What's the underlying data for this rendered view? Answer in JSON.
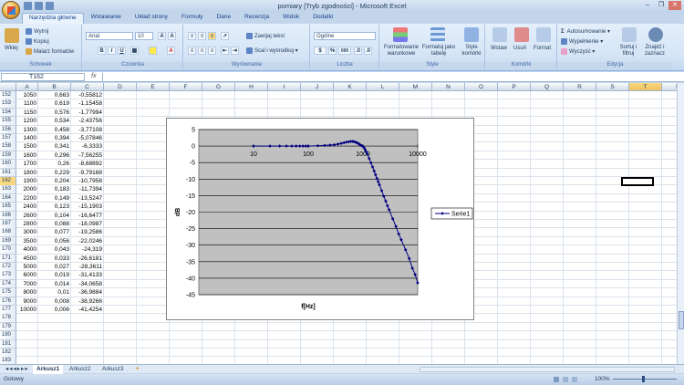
{
  "window": {
    "title": "pomiary  [Tryb zgodności] - Microsoft Excel",
    "min": "–",
    "restore": "❐",
    "close": "✕"
  },
  "tabs": [
    "Narzędzia główne",
    "Wstawianie",
    "Układ strony",
    "Formuły",
    "Dane",
    "Recenzja",
    "Widok",
    "Dodatki"
  ],
  "ribbon": {
    "clipboard": {
      "paste": "Wklej",
      "cut": "Wytnij",
      "copy": "Kopiuj",
      "painter": "Malarz formatów",
      "label": "Schowek"
    },
    "font": {
      "name": "Arial",
      "size": "10",
      "bold": "B",
      "italic": "I",
      "underline": "U",
      "label": "Czcionka"
    },
    "alignment": {
      "wrap": "Zawijaj tekst",
      "merge": "Scal i wyśrodkuj",
      "label": "Wyrównanie"
    },
    "number": {
      "format": "Ogólne",
      "label": "Liczba",
      "percent": "%",
      "thousands": "000"
    },
    "styles": {
      "cond": "Formatowanie warunkowe",
      "table": "Formatuj jako tabelę",
      "cell": "Style komórki",
      "label": "Style"
    },
    "cells": {
      "insert": "Wstaw",
      "delete": "Usuń",
      "format": "Format",
      "label": "Komórki"
    },
    "editing": {
      "autosum": "Autosumowanie",
      "fill": "Wypełnienie",
      "clear": "Wyczyść",
      "sort": "Sortuj i filtruj",
      "find": "Znajdź i zaznacz",
      "label": "Edycja"
    }
  },
  "namebox": "T162",
  "fx": "fx",
  "columns": [
    "A",
    "B",
    "C",
    "D",
    "E",
    "F",
    "G",
    "H",
    "I",
    "J",
    "K",
    "L",
    "M",
    "N",
    "O",
    "P",
    "Q",
    "R",
    "S",
    "T",
    "U"
  ],
  "rows": [
    {
      "n": "152",
      "a": "1050",
      "b": "0,663",
      "c": "-0,55812"
    },
    {
      "n": "153",
      "a": "1100",
      "b": "0,619",
      "c": "-1,15458"
    },
    {
      "n": "154",
      "a": "1150",
      "b": "0,576",
      "c": "-1,77994"
    },
    {
      "n": "155",
      "a": "1200",
      "b": "0,534",
      "c": "-2,43756"
    },
    {
      "n": "156",
      "a": "1300",
      "b": "0,458",
      "c": "-3,77108"
    },
    {
      "n": "157",
      "a": "1400",
      "b": "0,394",
      "c": "-5,07846"
    },
    {
      "n": "158",
      "a": "1500",
      "b": "0,341",
      "c": "-6,3333"
    },
    {
      "n": "159",
      "a": "1600",
      "b": "0,296",
      "c": "-7,56255"
    },
    {
      "n": "160",
      "a": "1700",
      "b": "0,26",
      "c": "-8,68892"
    },
    {
      "n": "161",
      "a": "1800",
      "b": "0,229",
      "c": "-9,79168"
    },
    {
      "n": "162",
      "a": "1900",
      "b": "0,204",
      "c": "-10,7958"
    },
    {
      "n": "163",
      "a": "2000",
      "b": "0,183",
      "c": "-11,7394"
    },
    {
      "n": "164",
      "a": "2200",
      "b": "0,149",
      "c": "-13,5247"
    },
    {
      "n": "165",
      "a": "2400",
      "b": "0,123",
      "c": "-15,1903"
    },
    {
      "n": "166",
      "a": "2600",
      "b": "0,104",
      "c": "-16,6477"
    },
    {
      "n": "167",
      "a": "2800",
      "b": "0,088",
      "c": "-18,0987"
    },
    {
      "n": "168",
      "a": "3000",
      "b": "0,077",
      "c": "-19,2586"
    },
    {
      "n": "169",
      "a": "3500",
      "b": "0,056",
      "c": "-22,0246"
    },
    {
      "n": "170",
      "a": "4000",
      "b": "0,043",
      "c": "-24,319"
    },
    {
      "n": "171",
      "a": "4500",
      "b": "0,033",
      "c": "-26,6181"
    },
    {
      "n": "172",
      "a": "5000",
      "b": "0,027",
      "c": "-28,3611"
    },
    {
      "n": "173",
      "a": "6000",
      "b": "0,019",
      "c": "-31,4133"
    },
    {
      "n": "174",
      "a": "7000",
      "b": "0,014",
      "c": "-34,0658"
    },
    {
      "n": "175",
      "a": "8000",
      "b": "0,01",
      "c": "-36,9884"
    },
    {
      "n": "176",
      "a": "9000",
      "b": "0,008",
      "c": "-38,9266"
    },
    {
      "n": "177",
      "a": "10000",
      "b": "0,006",
      "c": "-41,4254"
    },
    {
      "n": "178",
      "a": "",
      "b": "",
      "c": ""
    },
    {
      "n": "179",
      "a": "",
      "b": "",
      "c": ""
    },
    {
      "n": "180",
      "a": "",
      "b": "",
      "c": ""
    },
    {
      "n": "181",
      "a": "",
      "b": "",
      "c": ""
    },
    {
      "n": "182",
      "a": "",
      "b": "",
      "c": ""
    },
    {
      "n": "183",
      "a": "",
      "b": "",
      "c": ""
    }
  ],
  "sheets": [
    "Arkusz1",
    "Arkusz2",
    "Arkusz3"
  ],
  "status": {
    "ready": "Gotowy",
    "zoom": "100%"
  },
  "chart_data": {
    "type": "scatter",
    "xlabel": "f[Hz]",
    "ylabel": "dB",
    "xscale": "log",
    "xlim": [
      1,
      10000
    ],
    "ylim": [
      -45,
      5
    ],
    "xticks": [
      "10",
      "100",
      "1000",
      "10000"
    ],
    "yticks": [
      "5",
      "0",
      "-5",
      "-10",
      "-15",
      "-20",
      "-25",
      "-30",
      "-35",
      "-40",
      "-45"
    ],
    "grid": true,
    "legend": "right",
    "series": [
      {
        "name": "Serie1",
        "color": "#000080",
        "x": [
          10,
          20,
          30,
          40,
          50,
          60,
          70,
          80,
          90,
          100,
          150,
          200,
          250,
          300,
          350,
          400,
          450,
          500,
          550,
          600,
          650,
          700,
          750,
          800,
          850,
          900,
          950,
          1000,
          1050,
          1100,
          1150,
          1200,
          1300,
          1400,
          1500,
          1600,
          1700,
          1800,
          1900,
          2000,
          2200,
          2400,
          2600,
          2800,
          3000,
          3500,
          4000,
          4500,
          5000,
          6000,
          7000,
          8000,
          9000,
          10000
        ],
        "y": [
          0,
          0,
          0,
          0,
          0,
          0,
          0,
          0,
          0,
          0,
          0.1,
          0.2,
          0.3,
          0.4,
          0.6,
          0.8,
          1.0,
          1.2,
          1.3,
          1.4,
          1.4,
          1.3,
          1.1,
          0.9,
          0.6,
          0.3,
          0.1,
          -0.1,
          -0.55812,
          -1.15458,
          -1.77994,
          -2.43756,
          -3.77108,
          -5.07846,
          -6.3333,
          -7.56255,
          -8.68892,
          -9.79168,
          -10.7958,
          -11.7394,
          -13.5247,
          -15.1903,
          -16.6477,
          -18.0987,
          -19.2586,
          -22.0246,
          -24.319,
          -26.6181,
          -28.3611,
          -31.4133,
          -34.0658,
          -36.9884,
          -38.9266,
          -41.4254
        ]
      }
    ]
  }
}
